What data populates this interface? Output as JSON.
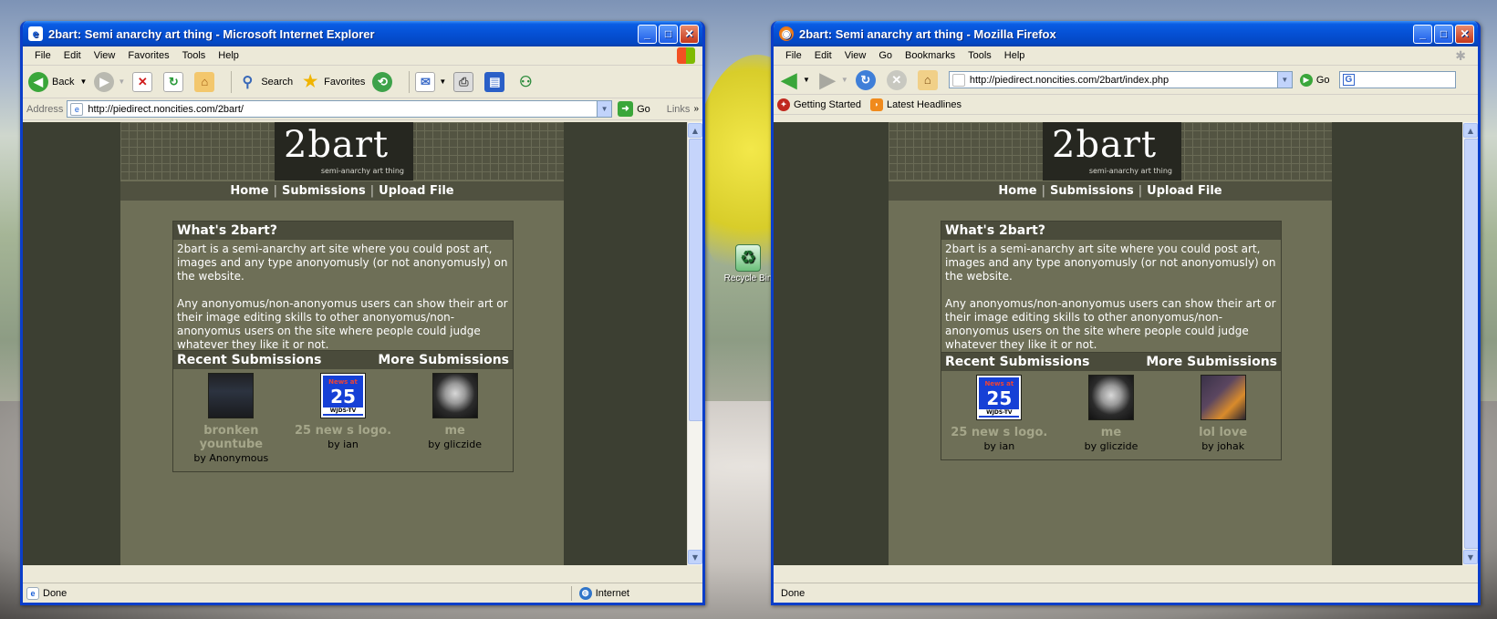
{
  "desktop": {
    "recycle_bin_label": "Recycle Bin"
  },
  "ie": {
    "title": "2bart: Semi anarchy art thing - Microsoft Internet Explorer",
    "menu": [
      "File",
      "Edit",
      "View",
      "Favorites",
      "Tools",
      "Help"
    ],
    "toolbar": {
      "back": "Back",
      "search": "Search",
      "favorites": "Favorites"
    },
    "address_label": "Address",
    "url": "http://piedirect.noncities.com/2bart/",
    "go_label": "Go",
    "links_label": "Links",
    "status": "Done",
    "zone": "Internet"
  },
  "ff": {
    "title": "2bart: Semi anarchy art thing - Mozilla Firefox",
    "menu": [
      "File",
      "Edit",
      "View",
      "Go",
      "Bookmarks",
      "Tools",
      "Help"
    ],
    "url": "http://piedirect.noncities.com/2bart/index.php",
    "go_label": "Go",
    "bookmarks": [
      "Getting Started",
      "Latest Headlines"
    ],
    "search_placeholder": "G",
    "status": "Done"
  },
  "site": {
    "logo": "2bart",
    "tagline": "semi-anarchy art thing",
    "nav": [
      "Home",
      "Submissions",
      "Upload File"
    ],
    "about": {
      "title": "What's 2bart?",
      "p1": "2bart is a semi-anarchy art site where you could post art, images and any type anonyomusly (or not anonyomusly) on the website.",
      "p2": "Any anonyomus/non-anonyomus users can show their art or their image editing skills to other anonyomus/non-anonyomus users on the site where people could judge whatever they like it or not."
    },
    "recent_label": "Recent Submissions",
    "more_label": "More Submissions",
    "ie_submissions": [
      {
        "title": "bronken yountube",
        "by": "by Anonymous"
      },
      {
        "title": "25 new s logo.",
        "by": "by ian"
      },
      {
        "title": "me",
        "by": "by gliczide"
      }
    ],
    "ff_submissions": [
      {
        "title": "25 new s logo.",
        "by": "by ian"
      },
      {
        "title": "me",
        "by": "by gliczide"
      },
      {
        "title": "lol love",
        "by": "by johak"
      }
    ],
    "news_thumb": {
      "top": "News at",
      "number": "25",
      "bottom": "WJDS-TV"
    }
  },
  "colors": {
    "xp_title_blue": "#0550d4",
    "page_bg": "#6e6f57",
    "viewport_bg": "#3c3f32",
    "sub_title": "#a5a68a"
  }
}
